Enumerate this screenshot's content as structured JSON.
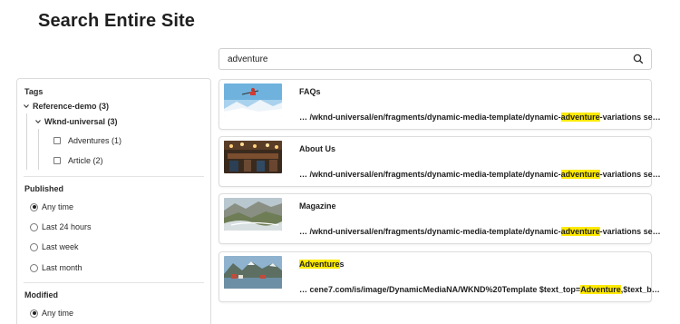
{
  "page": {
    "title": "Search Entire Site"
  },
  "search": {
    "value": "adventure",
    "placeholder": ""
  },
  "filters": {
    "tags_heading": "Tags",
    "tree": {
      "root_label": "Reference-demo (3)",
      "child_label": "Wknd-universal (3)",
      "leaves": [
        "Adventures (1)",
        "Article (2)"
      ]
    },
    "published_heading": "Published",
    "published_options": [
      {
        "label": "Any time",
        "selected": true
      },
      {
        "label": "Last 24 hours",
        "selected": false
      },
      {
        "label": "Last week",
        "selected": false
      },
      {
        "label": "Last month",
        "selected": false
      }
    ],
    "modified_heading": "Modified",
    "modified_options": [
      {
        "label": "Any time",
        "selected": true
      }
    ]
  },
  "results": [
    {
      "title": "FAQs",
      "snippet_pre": "… /wknd-universal/en/fragments/dynamic-media-template/dynamic-",
      "snippet_hl": "adventure",
      "snippet_post": "-variations se…",
      "thumb_icon": "skier-thumbnail-icon"
    },
    {
      "title": "About Us",
      "snippet_pre": "… /wknd-universal/en/fragments/dynamic-media-template/dynamic-",
      "snippet_hl": "adventure",
      "snippet_post": "-variations se…",
      "thumb_icon": "restaurant-thumbnail-icon"
    },
    {
      "title": "Magazine",
      "snippet_pre": "… /wknd-universal/en/fragments/dynamic-media-template/dynamic-",
      "snippet_hl": "adventure",
      "snippet_post": "-variations se…",
      "thumb_icon": "valley-thumbnail-icon"
    },
    {
      "title_hl": "Adventure",
      "title_post": "s",
      "snippet_pre": "… cene7.com/is/image/DynamicMediaNA/WKND%20Template $text_top=",
      "snippet_hl": "Adventure",
      "snippet_post": ",$text_b…",
      "thumb_icon": "fjord-thumbnail-icon"
    }
  ],
  "colors": {
    "highlight": "#ffea00",
    "border": "#dcdcdc",
    "text": "#1f1f1f"
  }
}
